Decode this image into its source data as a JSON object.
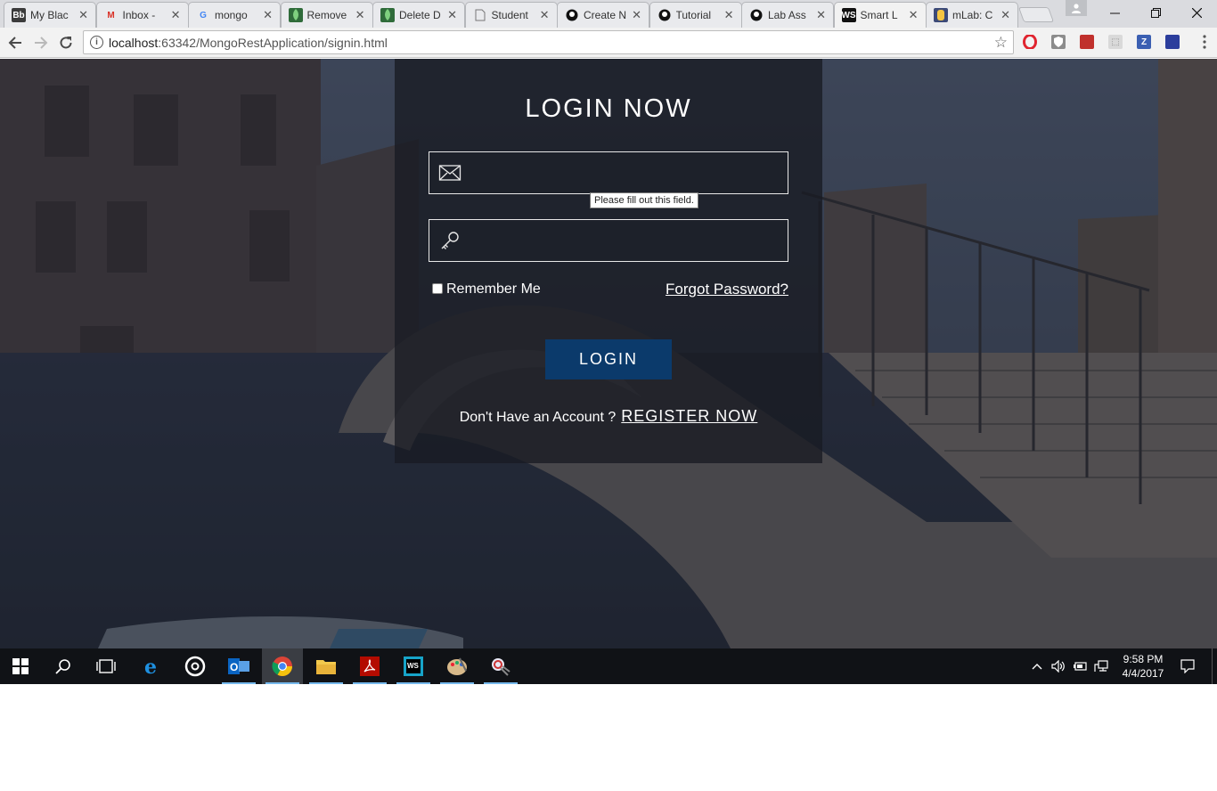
{
  "browser": {
    "tabs": [
      {
        "favicon": "Bb",
        "title": "My Blac",
        "active": false
      },
      {
        "favicon": "M",
        "title": "Inbox -",
        "active": false
      },
      {
        "favicon": "G",
        "title": "mongo",
        "active": false
      },
      {
        "favicon": "leaf",
        "title": "Remove",
        "active": false
      },
      {
        "favicon": "leaf",
        "title": "Delete D",
        "active": false
      },
      {
        "favicon": "doc",
        "title": "Student",
        "active": false
      },
      {
        "favicon": "gh",
        "title": "Create N",
        "active": false
      },
      {
        "favicon": "gh",
        "title": "Tutorial",
        "active": false
      },
      {
        "favicon": "gh",
        "title": "Lab Ass",
        "active": false
      },
      {
        "favicon": "WS",
        "title": "Smart L",
        "active": true
      },
      {
        "favicon": "mlab",
        "title": "mLab: C",
        "active": false
      }
    ],
    "close_glyph": "✕",
    "url_host": "localhost",
    "url_rest": ":63342/MongoRestApplication/signin.html"
  },
  "login": {
    "title": "LOGIN NOW",
    "email_placeholder": "",
    "password_placeholder": "",
    "tooltip": "Please fill out this field.",
    "remember_label": "Remember Me",
    "forgot_label": "Forgot Password?",
    "login_button": "LOGIN",
    "no_account_text": "Don't Have an Account ?",
    "register_link": "REGISTER NOW"
  },
  "taskbar": {
    "time": "9:58 PM",
    "date": "4/4/2017"
  },
  "colors": {
    "accent_button": "#0b3a6b",
    "panel": "#181b22",
    "taskbar": "#101216"
  }
}
